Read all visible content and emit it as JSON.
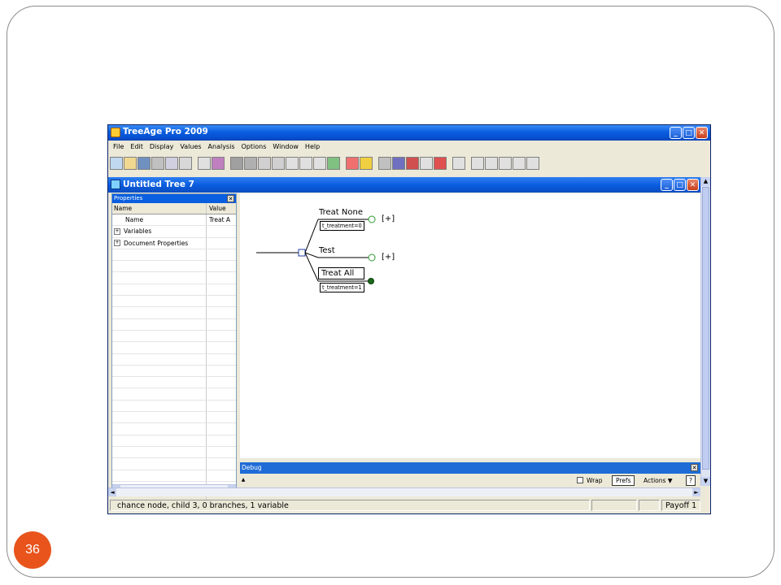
{
  "slide": {
    "number": "36"
  },
  "app": {
    "title": "TreeAge Pro 2009"
  },
  "menu": [
    "File",
    "Edit",
    "Display",
    "Values",
    "Analysis",
    "Options",
    "Window",
    "Help"
  ],
  "toolbar": {
    "buttons": [
      "new-icon",
      "open-icon",
      "save-icon",
      "print-icon",
      "print-preview-icon",
      "export-icon",
      "sep",
      "node-type-icon",
      "function-icon",
      "sep",
      "tree-icon",
      "variable-icon",
      "formula-icon",
      "markov-icon",
      "ellipsis-icon",
      "equals-icon",
      "clock-icon",
      "color-icon",
      "sep",
      "calculator-icon",
      "warning-icon",
      "sep",
      "bar-chart-icon",
      "sens-icon",
      "sens-color-icon",
      "calc-icon",
      "circle-icon",
      "sep",
      "move-icon",
      "sep",
      "arrow-icon",
      "square-icon",
      "circle-node-icon",
      "circle-ring-icon",
      "diamond-icon"
    ]
  },
  "tree_window": {
    "title": "Untitled Tree 7"
  },
  "properties": {
    "title": "Properties",
    "columns": [
      "Name",
      "Value"
    ],
    "rows": [
      {
        "name": "Name",
        "value": "Treat A",
        "expand": ""
      },
      {
        "name": "Variables",
        "value": "",
        "expand": "+"
      },
      {
        "name": "Document Properties",
        "value": "",
        "expand": "+"
      }
    ]
  },
  "tree": {
    "branches": [
      {
        "label": "Treat None",
        "formula": "t_treatment=0",
        "terminal": "[+]"
      },
      {
        "label": "Test",
        "formula": "",
        "terminal": "[+]"
      },
      {
        "label": "Treat All",
        "formula": "t_treatment=1",
        "terminal": ""
      }
    ]
  },
  "debug": {
    "title": "Debug",
    "wrap_label": "Wrap",
    "prefs_label": "Prefs",
    "actions_label": "Actions ▼",
    "help_label": "?"
  },
  "status": {
    "message": "chance node, child 3, 0 branches, 1 variable",
    "payoff": "Payoff 1"
  }
}
